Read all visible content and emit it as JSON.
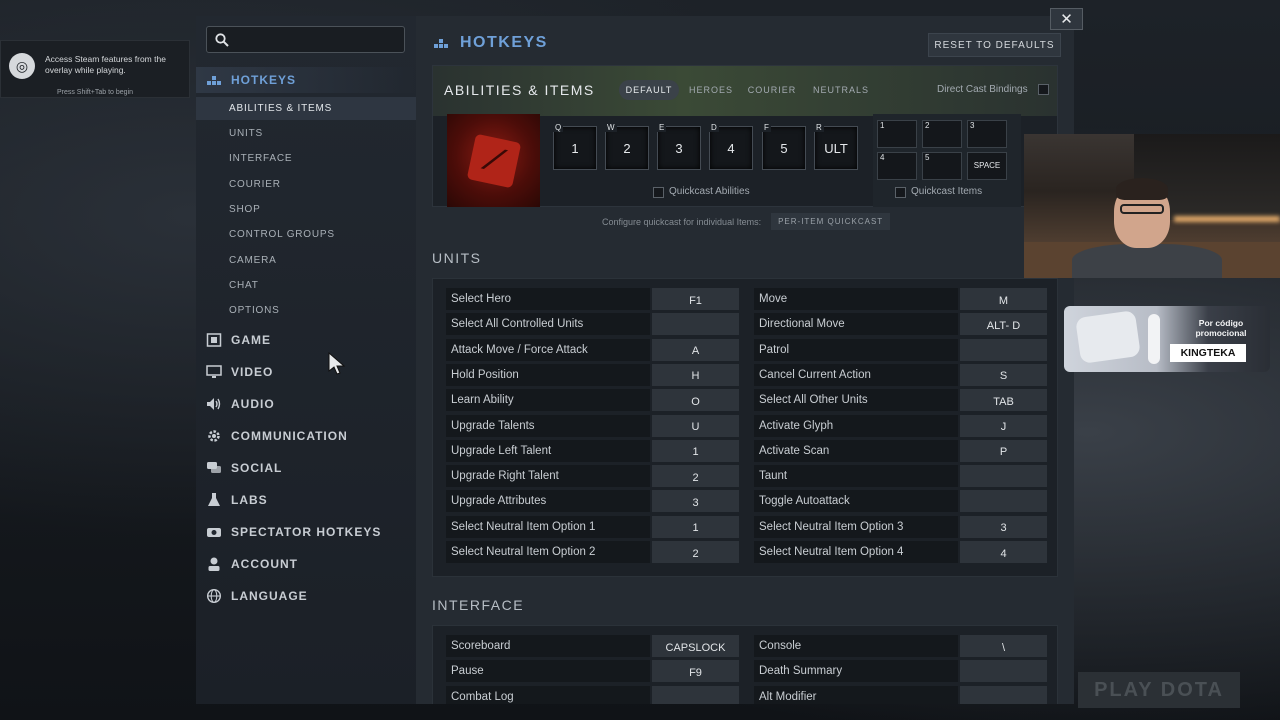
{
  "steam_overlay": {
    "message": "Access Steam features from the overlay while playing.",
    "hint": "Press Shift+Tab to begin"
  },
  "sidebar": {
    "search": {
      "value": "",
      "placeholder": ""
    },
    "main_items": [
      {
        "label": "HOTKEYS",
        "icon": "hotkeys-icon"
      },
      {
        "label": "GAME",
        "icon": "game-icon"
      },
      {
        "label": "VIDEO",
        "icon": "monitor-icon"
      },
      {
        "label": "AUDIO",
        "icon": "speaker-icon"
      },
      {
        "label": "COMMUNICATION",
        "icon": "gear-icon"
      },
      {
        "label": "SOCIAL",
        "icon": "chat-bubbles-icon"
      },
      {
        "label": "LABS",
        "icon": "flask-icon"
      },
      {
        "label": "SPECTATOR HOTKEYS",
        "icon": "spectator-icon"
      },
      {
        "label": "ACCOUNT",
        "icon": "user-icon"
      },
      {
        "label": "LANGUAGE",
        "icon": "globe-icon"
      }
    ],
    "sub_items": [
      "ABILITIES & ITEMS",
      "UNITS",
      "INTERFACE",
      "COURIER",
      "SHOP",
      "CONTROL GROUPS",
      "CAMERA",
      "CHAT",
      "OPTIONS"
    ]
  },
  "header": {
    "title": "HOTKEYS",
    "reset_label": "RESET TO DEFAULTS",
    "close_label": "✕"
  },
  "abilities": {
    "title": "ABILITIES & ITEMS",
    "tabs": [
      "DEFAULT",
      "HEROES",
      "COURIER",
      "NEUTRALS"
    ],
    "active_tab": "DEFAULT",
    "direct_cast_label": "Direct Cast Bindings",
    "slots": [
      {
        "letter": "Q",
        "key": "1"
      },
      {
        "letter": "W",
        "key": "2"
      },
      {
        "letter": "E",
        "key": "3"
      },
      {
        "letter": "D",
        "key": "4"
      },
      {
        "letter": "F",
        "key": "5"
      },
      {
        "letter": "R",
        "key": "ULT"
      }
    ],
    "quickcast_abilities_label": "Quickcast Abilities",
    "items": [
      {
        "letter": "1",
        "key": ""
      },
      {
        "letter": "2",
        "key": ""
      },
      {
        "letter": "3",
        "key": ""
      },
      {
        "letter": "4",
        "key": ""
      },
      {
        "letter": "5",
        "key": ""
      },
      {
        "letter": "",
        "key": "SPACE"
      }
    ],
    "quickcast_items_label": "Quickcast Items",
    "per_item_text": "Configure quickcast for individual Items:",
    "per_item_button": "PER-ITEM QUICKCAST"
  },
  "units": {
    "title": "UNITS",
    "left": [
      {
        "label": "Select Hero",
        "key": "F1"
      },
      {
        "label": "Select All Controlled Units",
        "key": ""
      },
      {
        "label": "Attack Move / Force Attack",
        "key": "A"
      },
      {
        "label": "Hold Position",
        "key": "H"
      },
      {
        "label": "Learn Ability",
        "key": "O"
      },
      {
        "label": "Upgrade Talents",
        "key": "U"
      },
      {
        "label": "Upgrade Left Talent",
        "key": "1"
      },
      {
        "label": "Upgrade Right Talent",
        "key": "2"
      },
      {
        "label": "Upgrade Attributes",
        "key": "3"
      },
      {
        "label": "Select Neutral Item Option 1",
        "key": "1"
      },
      {
        "label": "Select Neutral Item Option 2",
        "key": "2"
      }
    ],
    "right": [
      {
        "label": "Move",
        "key": "M"
      },
      {
        "label": "Directional Move",
        "key": "ALT- D"
      },
      {
        "label": "Patrol",
        "key": ""
      },
      {
        "label": "Cancel Current Action",
        "key": "S"
      },
      {
        "label": "Select All Other Units",
        "key": "TAB"
      },
      {
        "label": "Activate Glyph",
        "key": "J"
      },
      {
        "label": "Activate Scan",
        "key": "P"
      },
      {
        "label": "Taunt",
        "key": ""
      },
      {
        "label": "Toggle Autoattack",
        "key": ""
      },
      {
        "label": "Select Neutral Item Option 3",
        "key": "3"
      },
      {
        "label": "Select Neutral Item Option 4",
        "key": "4"
      }
    ]
  },
  "interface": {
    "title": "INTERFACE",
    "left": [
      {
        "label": "Scoreboard",
        "key": "CAPSLOCK"
      },
      {
        "label": "Pause",
        "key": "F9"
      },
      {
        "label": "Combat Log",
        "key": ""
      }
    ],
    "right": [
      {
        "label": "Console",
        "key": "\\"
      },
      {
        "label": "Death Summary",
        "key": ""
      },
      {
        "label": "Alt Modifier",
        "key": ""
      }
    ]
  },
  "promo": {
    "text": "Por código promocional",
    "code": "KINGTEKA"
  },
  "background": {
    "play_label": "PLAY DOTA"
  },
  "colors": {
    "accent": "#6fa0d8",
    "panel": "#252b32",
    "sidebar": "#222830"
  }
}
